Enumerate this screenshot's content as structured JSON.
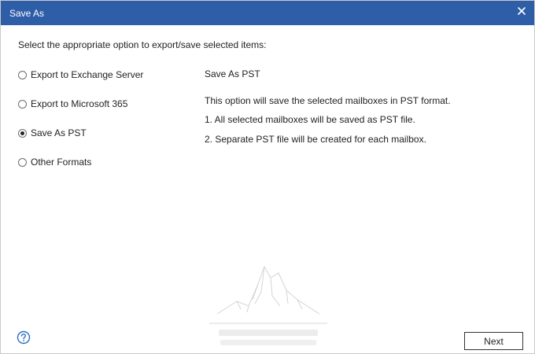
{
  "window": {
    "title": "Save As"
  },
  "instruction": "Select the appropriate option to export/save selected items:",
  "options": [
    {
      "label": "Export to Exchange Server",
      "selected": false
    },
    {
      "label": "Export to Microsoft 365",
      "selected": false
    },
    {
      "label": "Save As PST",
      "selected": true
    },
    {
      "label": "Other Formats",
      "selected": false
    }
  ],
  "detail": {
    "title": "Save As PST",
    "lines": [
      "This option will save the selected mailboxes in PST format.",
      "1. All selected mailboxes will be saved as PST file.",
      "2. Separate PST file will be created for each mailbox."
    ]
  },
  "footer": {
    "next_label": "Next"
  },
  "icons": {
    "close": "close-icon",
    "help": "help-icon"
  },
  "colors": {
    "titlebar": "#2f5ea8",
    "help_icon": "#2b6cc4"
  }
}
